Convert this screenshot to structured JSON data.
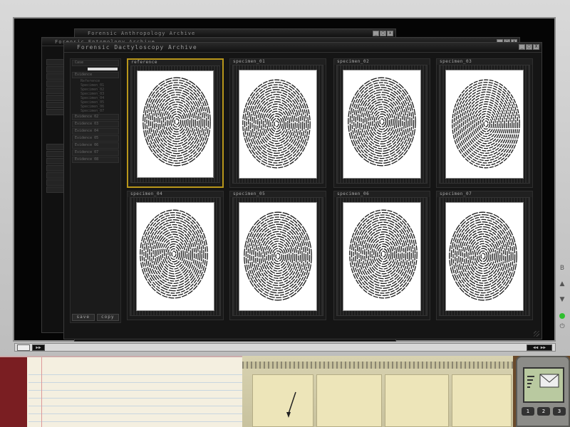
{
  "background_windows": [
    {
      "title": "Forensic Anthropology Archive"
    },
    {
      "title": "Forensic Entomology Archive"
    }
  ],
  "main_window": {
    "title": "Forensic Dactyloscopy Archive",
    "controls": [
      "_",
      "□",
      "X"
    ]
  },
  "left_panel": {
    "tree": [
      {
        "label": "Case",
        "children": []
      },
      {
        "label": "Evidence",
        "children": [
          "Reference",
          "Specimen_01",
          "Specimen_02",
          "Specimen_03",
          "Specimen_04",
          "Specimen_05",
          "Specimen_06",
          "Specimen_07"
        ]
      },
      {
        "label": "Evidence 02",
        "children": []
      },
      {
        "label": "Evidence 03",
        "children": []
      },
      {
        "label": "Evidence 04",
        "children": []
      },
      {
        "label": "Evidence 05",
        "children": []
      },
      {
        "label": "Evidence 06",
        "children": []
      },
      {
        "label": "Evidence 07",
        "children": []
      },
      {
        "label": "Evidence 08",
        "children": []
      }
    ],
    "buttons": {
      "save": "save",
      "copy": "copy"
    }
  },
  "cards": [
    {
      "label": "reference",
      "selected": true
    },
    {
      "label": "specimen_01",
      "selected": false
    },
    {
      "label": "specimen_02",
      "selected": false
    },
    {
      "label": "specimen_03",
      "selected": false
    },
    {
      "label": "specimen_04",
      "selected": false
    },
    {
      "label": "specimen_05",
      "selected": false
    },
    {
      "label": "specimen_06",
      "selected": false
    },
    {
      "label": "specimen_07",
      "selected": false
    }
  ],
  "taskbar": {
    "left_btn": "▶▶",
    "right_btn": "◀◀ ▶▶"
  },
  "monitor_side": {
    "icons": [
      "B",
      "▲",
      "▼",
      "⏻"
    ]
  },
  "colors": {
    "selection": "#b8961a",
    "screen": "#050505",
    "led": "#2fbf2f"
  }
}
